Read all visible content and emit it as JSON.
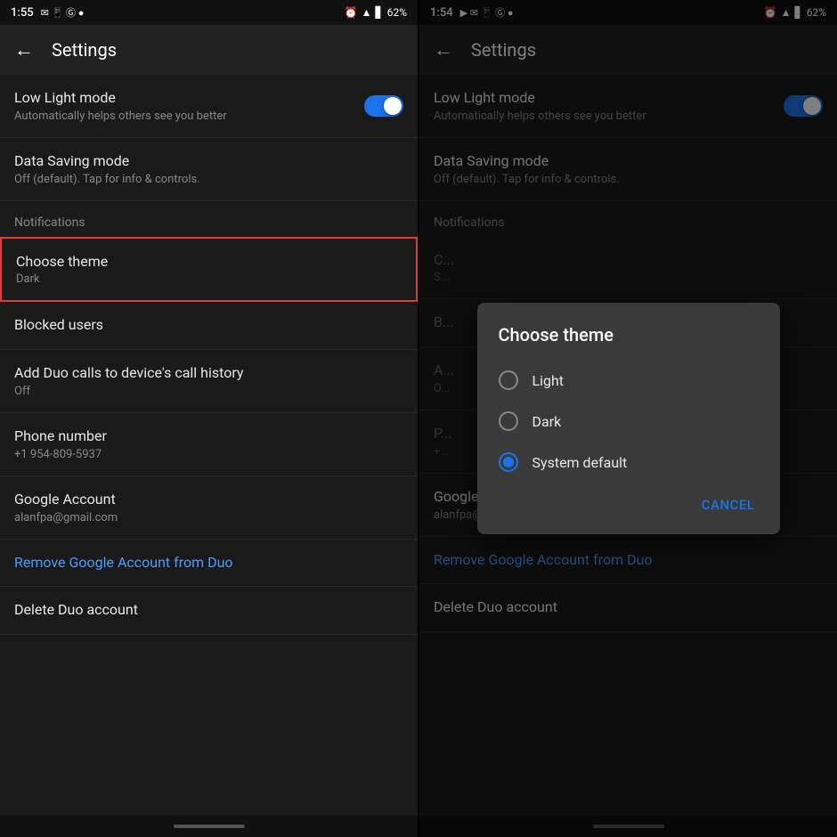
{
  "left_panel": {
    "status_bar": {
      "time": "1:55",
      "battery": "62%",
      "icons": [
        "Gmail",
        "phone",
        "G",
        "clock",
        "alarm",
        "wifi",
        "signal",
        "battery"
      ]
    },
    "top_bar": {
      "back_label": "←",
      "title": "Settings"
    },
    "settings": [
      {
        "id": "low-light",
        "label": "Low Light mode",
        "sublabel": "Automatically helps others see you better",
        "has_toggle": true,
        "toggle_on": true,
        "highlighted": false
      },
      {
        "id": "data-saving",
        "label": "Data Saving mode",
        "sublabel": "Off (default). Tap for info & controls.",
        "has_toggle": false,
        "highlighted": false
      },
      {
        "id": "notifications-header",
        "type": "section-header",
        "label": "Notifications"
      },
      {
        "id": "choose-theme",
        "label": "Choose theme",
        "sublabel": "Dark",
        "has_toggle": false,
        "highlighted": true
      },
      {
        "id": "blocked-users",
        "label": "Blocked users",
        "sublabel": "",
        "has_toggle": false,
        "highlighted": false
      },
      {
        "id": "add-duo-calls",
        "label": "Add Duo calls to device's call history",
        "sublabel": "Off",
        "has_toggle": false,
        "highlighted": false
      },
      {
        "id": "phone-number",
        "label": "Phone number",
        "sublabel": "+1 954-809-5937",
        "has_toggle": false,
        "highlighted": false
      },
      {
        "id": "google-account",
        "label": "Google Account",
        "sublabel": "alanfpa@gmail.com",
        "has_toggle": false,
        "highlighted": false
      },
      {
        "id": "remove-google",
        "label": "Remove Google Account from Duo",
        "sublabel": "",
        "is_link": true,
        "has_toggle": false,
        "highlighted": false
      },
      {
        "id": "delete-duo",
        "label": "Delete Duo account",
        "sublabel": "",
        "has_toggle": false,
        "highlighted": false
      }
    ]
  },
  "right_panel": {
    "status_bar": {
      "time": "1:54",
      "battery": "62%"
    },
    "top_bar": {
      "back_label": "←",
      "title": "Settings"
    },
    "dialog": {
      "title": "Choose theme",
      "options": [
        {
          "id": "light",
          "label": "Light",
          "selected": false
        },
        {
          "id": "dark",
          "label": "Dark",
          "selected": false
        },
        {
          "id": "system-default",
          "label": "System default",
          "selected": true
        }
      ],
      "cancel_label": "Cancel"
    },
    "settings": [
      {
        "id": "low-light",
        "label": "Low Light mode",
        "sublabel": "Automatically helps others see you better",
        "has_toggle": true,
        "toggle_on": true
      },
      {
        "id": "data-saving",
        "label": "Data Saving mode",
        "sublabel": "Off (default). Tap for info & controls.",
        "has_toggle": false
      },
      {
        "id": "notifications-header",
        "type": "section-header",
        "label": "Notifications"
      },
      {
        "id": "choose-theme-blurred",
        "label": "C...",
        "sublabel": "S...",
        "has_toggle": false
      },
      {
        "id": "blocked-users-blurred",
        "label": "B...",
        "sublabel": "",
        "has_toggle": false
      },
      {
        "id": "google-account",
        "label": "Google Account",
        "sublabel": "alanfpa@gmail.com",
        "has_toggle": false
      },
      {
        "id": "remove-google",
        "label": "Remove Google Account from Duo",
        "sublabel": "",
        "is_link": true,
        "has_toggle": false
      },
      {
        "id": "delete-duo",
        "label": "Delete Duo account",
        "sublabel": "",
        "has_toggle": false
      }
    ]
  }
}
